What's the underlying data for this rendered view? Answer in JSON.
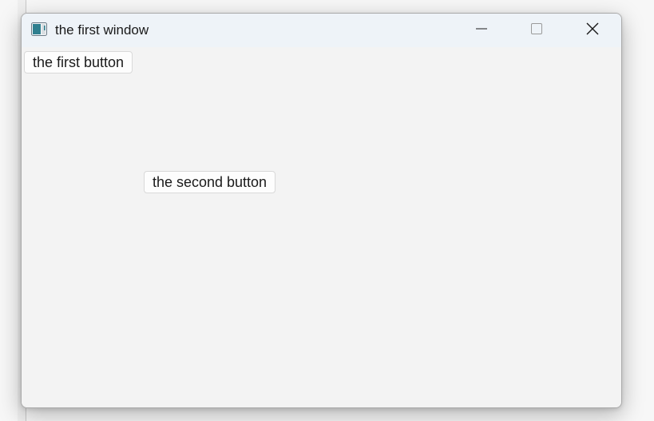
{
  "window": {
    "title": "the first window",
    "controls": {
      "minimize_icon": "minimize-icon",
      "maximize_icon": "maximize-icon",
      "close_icon": "close-icon"
    }
  },
  "buttons": {
    "first_label": "the first button",
    "second_label": "the second button"
  },
  "colors": {
    "titlebar": "#eef3f8",
    "client_area": "#f3f3f3",
    "button_face": "#fdfdfd",
    "button_border": "#d9d9d9",
    "text": "#1a1a1a"
  }
}
